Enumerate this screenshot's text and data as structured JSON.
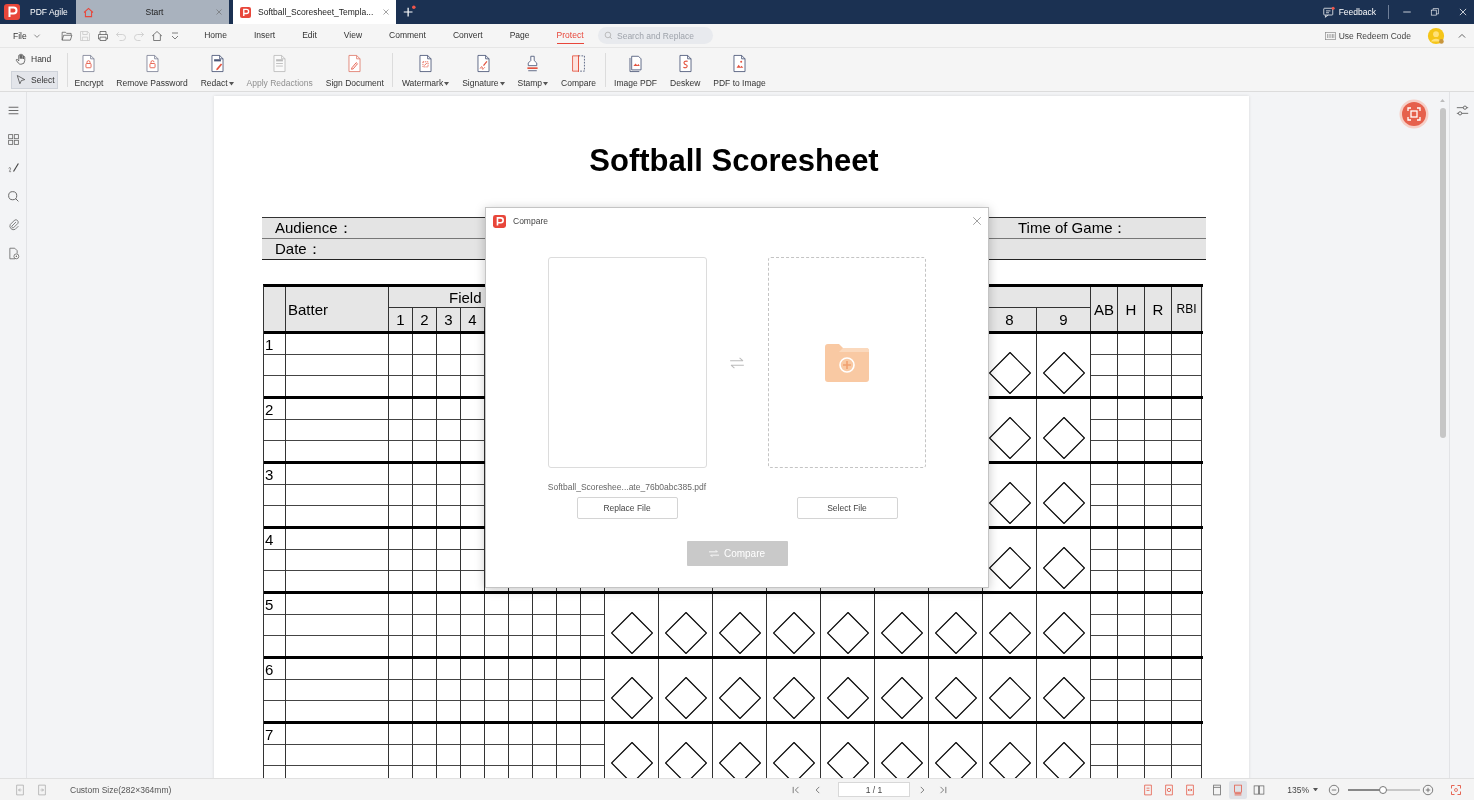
{
  "title_bar": {
    "app_name": "PDF Agile",
    "tabs": [
      {
        "label": "Start",
        "selected": false
      },
      {
        "label": "Softball_Scoresheet_Templa...",
        "selected": true
      }
    ],
    "feedback": "Feedback"
  },
  "menu_bar": {
    "file": "File",
    "quick_access": [
      {
        "disabled": false
      },
      {
        "disabled": true
      },
      {
        "disabled": false
      },
      {
        "disabled": true
      },
      {
        "disabled": true
      },
      {
        "disabled": false
      },
      {
        "disabled": false
      }
    ],
    "items": [
      {
        "label": "Home",
        "selected": false
      },
      {
        "label": "Insert",
        "selected": false
      },
      {
        "label": "Edit",
        "selected": false
      },
      {
        "label": "View",
        "selected": false
      },
      {
        "label": "Comment",
        "selected": false
      },
      {
        "label": "Convert",
        "selected": false
      },
      {
        "label": "Page",
        "selected": false
      },
      {
        "label": "Protect",
        "selected": true
      }
    ],
    "search": {
      "placeholder": "Search and Replace"
    },
    "redeem": "Use Redeem Code"
  },
  "toolbar": {
    "modes": [
      {
        "label": "Hand",
        "selected": false
      },
      {
        "label": "Select",
        "selected": true
      }
    ],
    "tools": [
      {
        "label": "Encrypt",
        "dropdown": false,
        "disabled": false
      },
      {
        "label": "Remove Password",
        "dropdown": false,
        "disabled": false
      },
      {
        "label": "Redact",
        "dropdown": true,
        "disabled": false
      },
      {
        "label": "Apply Redactions",
        "dropdown": false,
        "disabled": true
      },
      {
        "label": "Sign Document",
        "dropdown": false,
        "disabled": false
      },
      {
        "label": "Watermark",
        "dropdown": true,
        "disabled": false
      },
      {
        "label": "Signature",
        "dropdown": true,
        "disabled": false
      },
      {
        "label": "Stamp",
        "dropdown": true,
        "disabled": false
      },
      {
        "label": "Compare",
        "dropdown": false,
        "disabled": false
      },
      {
        "label": "Image PDF",
        "dropdown": false,
        "disabled": false
      },
      {
        "label": "Deskew",
        "dropdown": false,
        "disabled": false
      },
      {
        "label": "PDF to Image",
        "dropdown": false,
        "disabled": false
      }
    ]
  },
  "document": {
    "title": "Softball Scoresheet",
    "info_rows": [
      [
        "Audience：",
        "Time of Game："
      ],
      [
        "Date："
      ]
    ],
    "table": {
      "batter_heading": "Batter",
      "fielding_heading": "Field",
      "position_numbers": [
        "1",
        "2",
        "3",
        "4"
      ],
      "inning_numbers": [
        "8",
        "9"
      ],
      "stat_headings": [
        "AB",
        "H",
        "R",
        "RBI"
      ],
      "batters": [
        "1",
        "2",
        "3",
        "4",
        "5",
        "6",
        "7"
      ]
    }
  },
  "compare_dialog": {
    "title": "Compare",
    "file_name": "Softball_Scoreshee...ate_76b0abc385.pdf",
    "replace_button": "Replace File",
    "select_button": "Select File",
    "compare_button": {
      "label": "Compare",
      "disabled": true
    }
  },
  "status_bar": {
    "page_size": "Custom Size(282×364mm)",
    "page": "1 / 1",
    "view_modes": [
      {
        "selected": false
      },
      {
        "selected": true
      },
      {
        "selected": false
      }
    ],
    "zoom": "135%",
    "zoom_slider": {
      "level": 0.49
    }
  }
}
